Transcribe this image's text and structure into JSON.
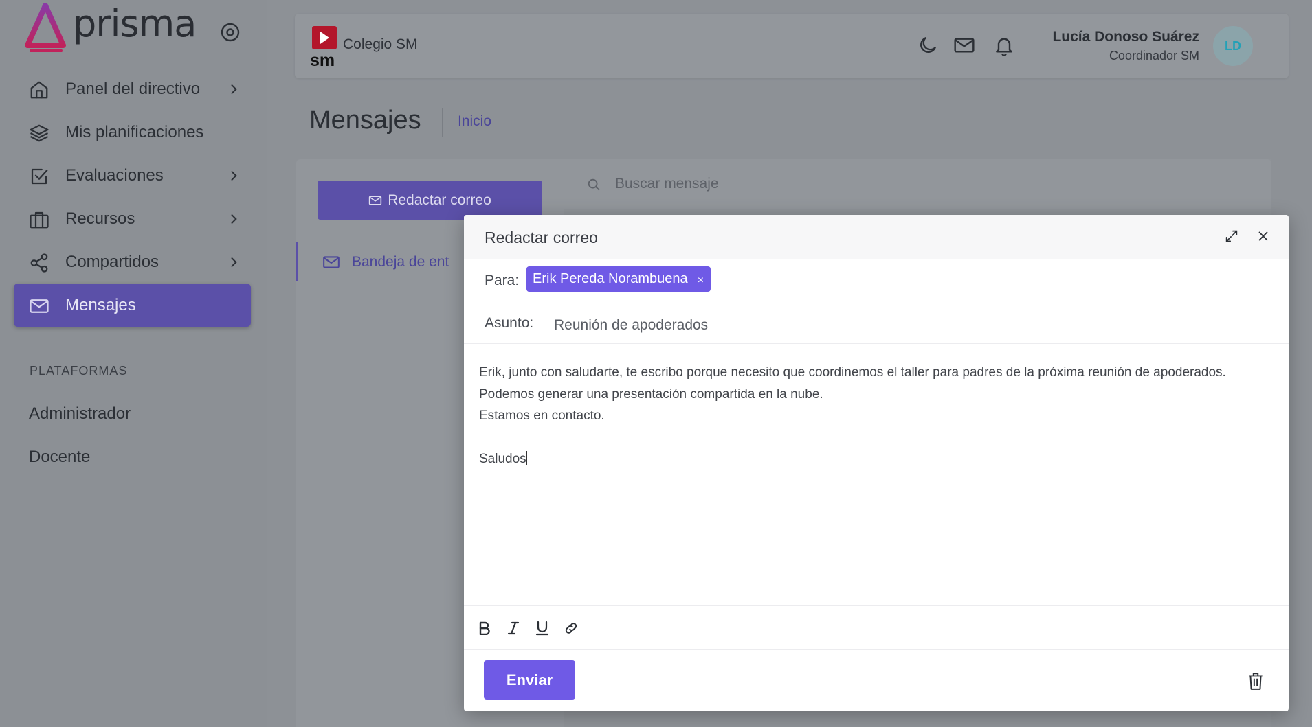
{
  "app": {
    "brand": "prisma",
    "accent_color": "#6f5ae6"
  },
  "sidebar": {
    "items": [
      {
        "label": "Panel del directivo",
        "icon": "home-icon",
        "has_submenu": true
      },
      {
        "label": "Mis planificaciones",
        "icon": "layers-icon",
        "has_submenu": false
      },
      {
        "label": "Evaluaciones",
        "icon": "checkbox-icon",
        "has_submenu": true
      },
      {
        "label": "Recursos",
        "icon": "briefcase-icon",
        "has_submenu": true
      },
      {
        "label": "Compartidos",
        "icon": "share-icon",
        "has_submenu": true
      },
      {
        "label": "Mensajes",
        "icon": "mail-icon",
        "has_submenu": false,
        "active": true
      }
    ],
    "section_title": "PLATAFORMAS",
    "platforms": [
      "Administrador",
      "Docente"
    ]
  },
  "header": {
    "school_name": "Colegio SM",
    "school_logo_text": "sm",
    "user_name": "Lucía Donoso Suárez",
    "user_role": "Coordinador SM",
    "avatar_initials": "LD"
  },
  "page": {
    "title": "Mensajes",
    "breadcrumb": "Inicio"
  },
  "mail": {
    "compose_label": "Redactar correo",
    "inbox_label": "Bandeja de ent",
    "search_placeholder": "Buscar mensaje"
  },
  "compose_modal": {
    "title": "Redactar correo",
    "to_label": "Para:",
    "recipient": "Erik Pereda Norambuena",
    "recipient_remove": "×",
    "subject_label": "Asunto:",
    "subject_value": "Reunión de apoderados",
    "body_lines": [
      "Erik, junto con saludarte, te escribo porque necesito que coordinemos el taller para padres de la próxima reunión de apoderados.",
      "Podemos generar una presentación compartida en la nube.",
      "Estamos en contacto.",
      "",
      "Saludos"
    ],
    "toolbar": [
      "bold",
      "italic",
      "underline",
      "link"
    ],
    "send_label": "Enviar"
  }
}
